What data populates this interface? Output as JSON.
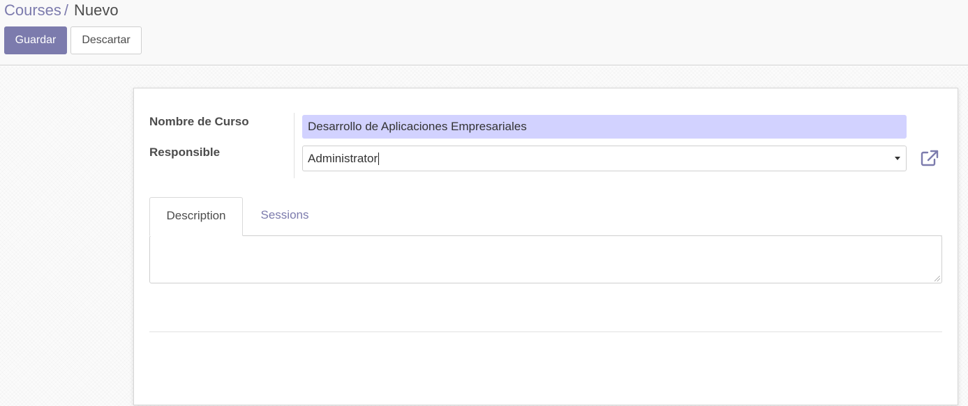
{
  "breadcrumb": {
    "parent": "Courses",
    "separator": "/",
    "current": "Nuevo"
  },
  "toolbar": {
    "save_label": "Guardar",
    "discard_label": "Descartar"
  },
  "form": {
    "name_label": "Nombre de Curso",
    "name_value": "Desarrollo de Aplicaciones Empresariales",
    "responsible_label": "Responsible",
    "responsible_value": "Administrator",
    "external_link_icon": "external-link-icon"
  },
  "notebook": {
    "tabs": [
      {
        "label": "Description",
        "active": true
      },
      {
        "label": "Sessions",
        "active": false
      }
    ],
    "description_value": ""
  },
  "colors": {
    "brand": "#7c7bad",
    "required_field_bg": "#d2d2ff",
    "text": "#4c4c4c"
  }
}
